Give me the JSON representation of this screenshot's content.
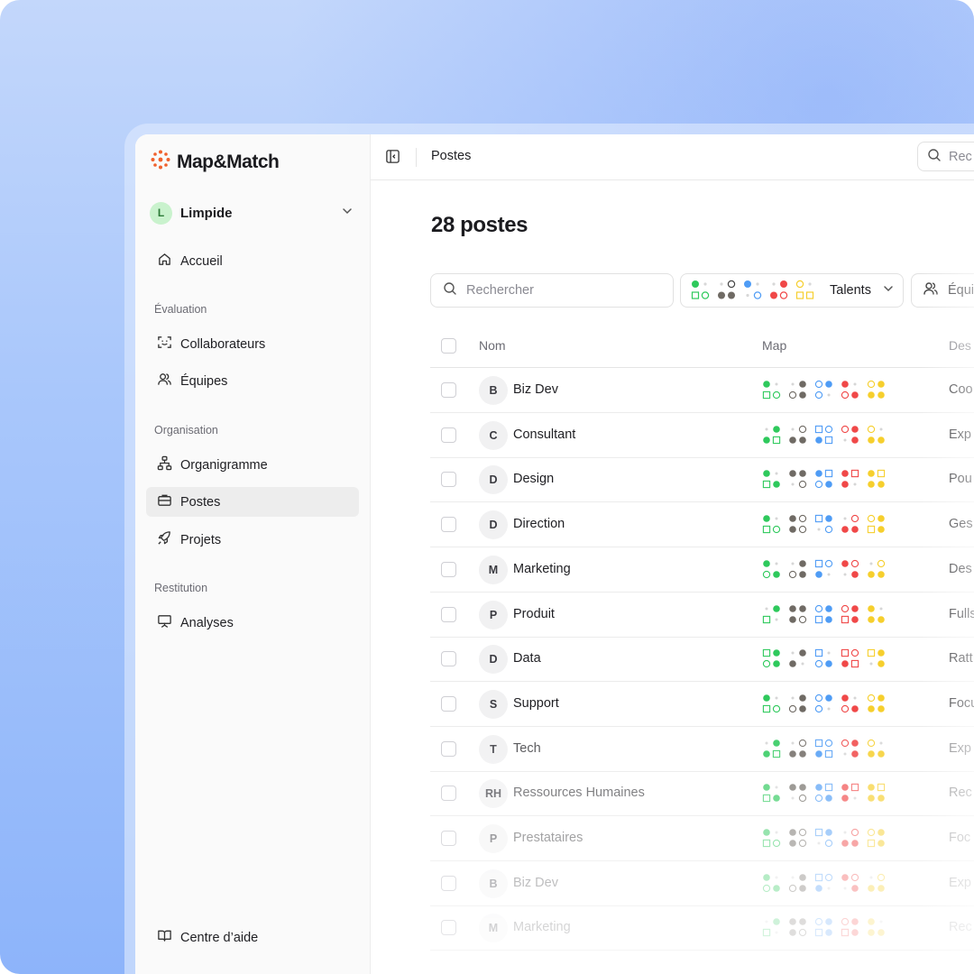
{
  "colors": {
    "green": "#2ec95c",
    "gray": "#6f6a64",
    "blue": "#4f9cf5",
    "red": "#f04848",
    "yellow": "#f6cf2d",
    "accent_logo": "#f0612d",
    "active_nav_bg": "#ededed"
  },
  "app": {
    "name": "Map&Match"
  },
  "workspace": {
    "initial": "L",
    "name": "Limpide"
  },
  "sidebar": {
    "home": "Accueil",
    "sections": [
      {
        "title": "Évaluation",
        "items": [
          "Collaborateurs",
          "Équipes"
        ]
      },
      {
        "title": "Organisation",
        "items": [
          "Organigramme",
          "Postes",
          "Projets"
        ]
      },
      {
        "title": "Restitution",
        "items": [
          "Analyses"
        ]
      }
    ],
    "help": "Centre d’aide"
  },
  "topbar": {
    "title": "Postes",
    "search_placeholder": "Rec"
  },
  "page": {
    "title": "28 postes",
    "search_placeholder": "Rechercher",
    "filter_talents": "Talents",
    "filter_equipes": "Équi"
  },
  "table": {
    "columns": [
      "Nom",
      "Map",
      "Des"
    ],
    "rows": [
      {
        "initials": "B",
        "name": "Biz Dev",
        "desc": "Coo"
      },
      {
        "initials": "C",
        "name": "Consultant",
        "desc": "Exp"
      },
      {
        "initials": "D",
        "name": "Design",
        "desc": "Pou"
      },
      {
        "initials": "D",
        "name": "Direction",
        "desc": "Ges"
      },
      {
        "initials": "M",
        "name": "Marketing",
        "desc": "Des"
      },
      {
        "initials": "P",
        "name": "Produit",
        "desc": "Fulls"
      },
      {
        "initials": "D",
        "name": "Data",
        "desc": "Ratt"
      },
      {
        "initials": "S",
        "name": "Support",
        "desc": "Focu"
      },
      {
        "initials": "T",
        "name": "Tech",
        "desc": "Exp"
      },
      {
        "initials": "RH",
        "name": "Ressources Humaines",
        "desc": "Rec"
      },
      {
        "initials": "P",
        "name": "Prestataires",
        "desc": "Foc"
      },
      {
        "initials": "B",
        "name": "Biz Dev",
        "desc": "Exp"
      },
      {
        "initials": "M",
        "name": "Marketing",
        "desc": "Rec"
      }
    ]
  }
}
